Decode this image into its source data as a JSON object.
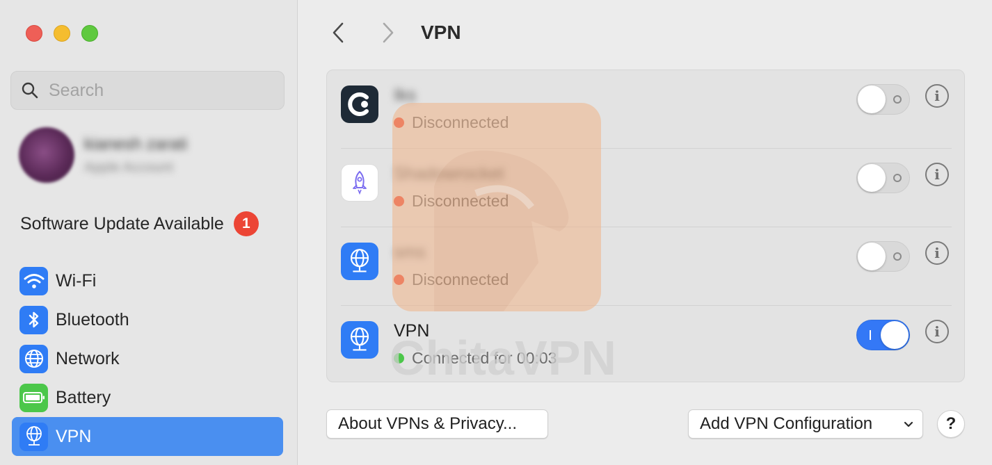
{
  "sidebar": {
    "search": {
      "placeholder": "Search"
    },
    "account": {
      "name": "kianesh zarati",
      "subtitle": "Apple Account"
    },
    "update": {
      "label": "Software Update Available",
      "badge": "1"
    },
    "items": [
      {
        "label": "Wi-Fi",
        "icon": "wifi-icon",
        "color": "#2f7cf5"
      },
      {
        "label": "Bluetooth",
        "icon": "bluetooth-icon",
        "color": "#2f7cf5"
      },
      {
        "label": "Network",
        "icon": "globe-icon",
        "color": "#2f7cf5"
      },
      {
        "label": "Battery",
        "icon": "battery-icon",
        "color": "#4cc74a"
      },
      {
        "label": "VPN",
        "icon": "vpn-globe-icon",
        "color": "#2f7cf5",
        "active": true
      }
    ]
  },
  "header": {
    "title": "VPN"
  },
  "vpns": [
    {
      "name": "Iks",
      "status": "Disconnected",
      "connected": false,
      "icon": "cisco-icon"
    },
    {
      "name": "Shadowrocket",
      "status": "Disconnected",
      "connected": false,
      "icon": "rocket-icon"
    },
    {
      "name": "sms",
      "status": "Disconnected",
      "connected": false,
      "icon": "vpn-globe-icon"
    },
    {
      "name": "VPN",
      "status": "Connected for 00:03",
      "connected": true,
      "icon": "vpn-globe-icon"
    }
  ],
  "footer": {
    "about_label": "About VPNs & Privacy...",
    "add_label": "Add VPN Configuration",
    "help_label": "?"
  },
  "watermark": {
    "text": "ChitaVPN"
  },
  "colors": {
    "accent": "#3478f6",
    "sidebar_active": "#4a8ff0",
    "status_red": "#ea4a37",
    "status_green": "#4cc74a",
    "badge_red": "#ec4535"
  }
}
